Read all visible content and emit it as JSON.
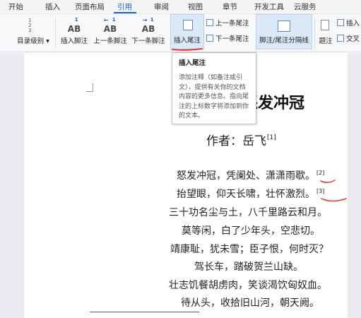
{
  "tabs": [
    {
      "label": "开始",
      "active": false
    },
    {
      "label": "插入",
      "active": false
    },
    {
      "label": "页面布局",
      "active": false
    },
    {
      "label": "引用",
      "active": true
    },
    {
      "label": "审阅",
      "active": false
    },
    {
      "label": "视图",
      "active": false
    },
    {
      "label": "章节",
      "active": false
    },
    {
      "label": "开发工具",
      "active": false
    },
    {
      "label": "云服务",
      "active": false
    }
  ],
  "ribbon": {
    "toc_level": "目录级别",
    "insert_footnote": "插入脚注",
    "prev_footnote": "上一条脚注",
    "next_footnote": "下一条脚注",
    "insert_endnote": "插入尾注",
    "prev_endnote": "上一条尾注",
    "next_endnote": "下一条尾注",
    "separator": "脚注/尾注分隔线",
    "caption": "题注",
    "insert_right": "插入",
    "cross_ref": "交叉"
  },
  "tooltip": {
    "title": "插入尾注",
    "body": "添加注释（如备注或引文），提供有关你的文档内容的更多信息。指向尾注的上标数字将添加到你的文本。"
  },
  "document": {
    "title": "怒发冲冠",
    "author": "作者：岳飞",
    "author_note": "[1]",
    "lines": [
      {
        "text": "怒发冲冠，凭阑处、潇潇雨歇。",
        "note": "[2]"
      },
      {
        "text": "抬望眼，仰天长啸，壮怀激烈。",
        "note": "[3]"
      },
      {
        "text": "三十功名尘与土，八千里路云和月。",
        "note": ""
      },
      {
        "text": "莫等闲，白了少年头，空悲切。",
        "note": ""
      },
      {
        "text": "靖康耻，犹未雪；臣子恨，何时灭？",
        "note": ""
      },
      {
        "text": "驾长车，踏破贺兰山缺。",
        "note": ""
      },
      {
        "text": "壮志饥餐胡虏肉，笑谈渴饮匈奴血。",
        "note": ""
      },
      {
        "text": "待从头，收拾旧山河，朝天阙。",
        "note": ""
      }
    ]
  },
  "colors": {
    "accent": "#1a63d6",
    "annotation": "#e53935"
  }
}
